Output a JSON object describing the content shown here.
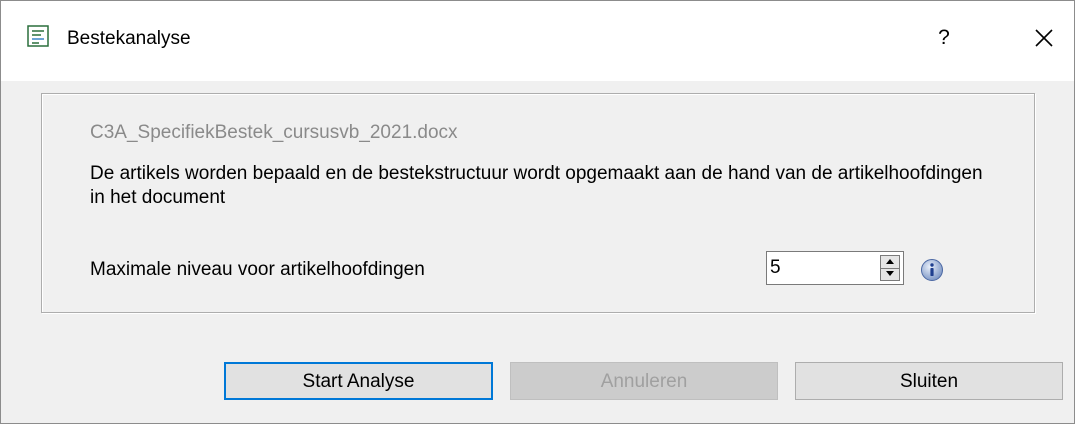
{
  "window": {
    "title": "Bestekanalyse",
    "help_label": "?",
    "close_icon": "close-icon",
    "app_icon": "document-list-icon"
  },
  "content": {
    "file_name": "C3A_SpecifiekBestek_cursusvb_2021.docx",
    "description": "De artikels worden bepaald en de bestekstructuur wordt opgemaakt aan de hand van de artikelhoofdingen in het document",
    "level_label": "Maximale niveau voor artikelhoofdingen",
    "level_value": "5",
    "info_icon": "info-icon"
  },
  "buttons": {
    "start": "Start Analyse",
    "cancel": "Annuleren",
    "close": "Sluiten"
  },
  "colors": {
    "accent": "#0078d7",
    "dialog_bg": "#f0f0f0",
    "disabled_text": "#a0a0a0",
    "file_name_text": "#8a8a8a"
  }
}
